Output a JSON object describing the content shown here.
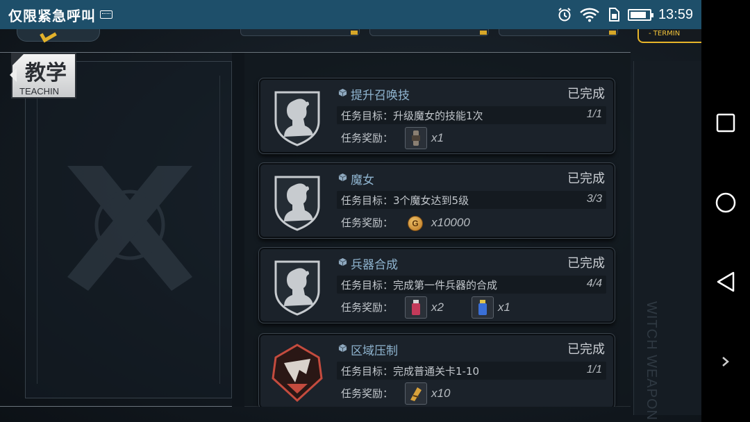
{
  "statusbar": {
    "title": "仅限紧急呼叫",
    "time": "13:59",
    "battery_level": 0.85
  },
  "topbar": {
    "terminal_label": "- TERMIN"
  },
  "side": {
    "teaching_cn": "教学",
    "teaching_en": "TEACHIN",
    "watermark": "WITCH WEAPON"
  },
  "labels": {
    "goal": "任务目标：",
    "reward": "任务奖励："
  },
  "missions": [
    {
      "title": "提升召唤技",
      "status": "已完成",
      "goal": "升级魔女的技能1次",
      "progress": "1/1",
      "emblem": "witch-silhouette-icon",
      "rewards": [
        {
          "icon": "skill-scroll-icon",
          "qty": "x1"
        }
      ]
    },
    {
      "title": "魔女",
      "status": "已完成",
      "goal": "3个魔女达到5级",
      "progress": "3/3",
      "emblem": "witch-silhouette-icon",
      "rewards": [
        {
          "icon": "gold-coin-icon",
          "qty": "x10000"
        }
      ]
    },
    {
      "title": "兵器合成",
      "status": "已完成",
      "goal": "完成第一件兵器的合成",
      "progress": "4/4",
      "emblem": "witch-silhouette-icon",
      "rewards": [
        {
          "icon": "red-exp-potion-icon",
          "qty": "x2"
        },
        {
          "icon": "blue-exp-potion-icon",
          "qty": "x1"
        }
      ]
    },
    {
      "title": "区域压制",
      "status": "已完成",
      "goal": "完成普通关卡1-10",
      "progress": "1/1",
      "emblem": "red-masked-emblem-icon",
      "rewards": [
        {
          "icon": "stamina-item-icon",
          "qty": "x10"
        }
      ]
    }
  ],
  "colors": {
    "statusbar": "#1e4f6a",
    "accent": "#e7b52a",
    "title_blue": "#8fb4cf",
    "emblem_red": "#c44b3e"
  }
}
